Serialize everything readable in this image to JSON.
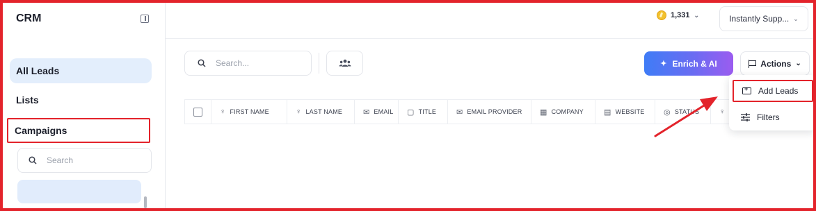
{
  "sidebar": {
    "title": "CRM",
    "items": [
      {
        "label": "All Leads"
      },
      {
        "label": "Lists"
      },
      {
        "label": "Campaigns"
      }
    ],
    "search_placeholder": "Search"
  },
  "header": {
    "credits": "1,331",
    "workspace": "Instantly Supp..."
  },
  "toolbar": {
    "search_placeholder": "Search...",
    "enrich_label": "Enrich & AI",
    "actions_label": "Actions"
  },
  "table": {
    "columns": [
      {
        "label": "FIRST NAME",
        "icon": "person-icon"
      },
      {
        "label": "LAST NAME",
        "icon": "person-icon"
      },
      {
        "label": "EMAIL",
        "icon": "mail-icon"
      },
      {
        "label": "TITLE",
        "icon": "briefcase-icon"
      },
      {
        "label": "EMAIL PROVIDER",
        "icon": "mail-icon"
      },
      {
        "label": "COMPANY",
        "icon": "building-icon"
      },
      {
        "label": "WEBSITE",
        "icon": "globe-icon"
      },
      {
        "label": "STATUS",
        "icon": "status-icon"
      }
    ]
  },
  "dropdown": {
    "items": [
      {
        "label": "Add Leads",
        "icon": "folder-plus-icon"
      },
      {
        "label": "Filters",
        "icon": "sliders-icon"
      }
    ]
  },
  "colors": {
    "highlight": "#e3232b",
    "active_bg": "#e3eefc",
    "enrich_gradient_start": "#3f7cf6",
    "enrich_gradient_end": "#9b5cf0"
  }
}
